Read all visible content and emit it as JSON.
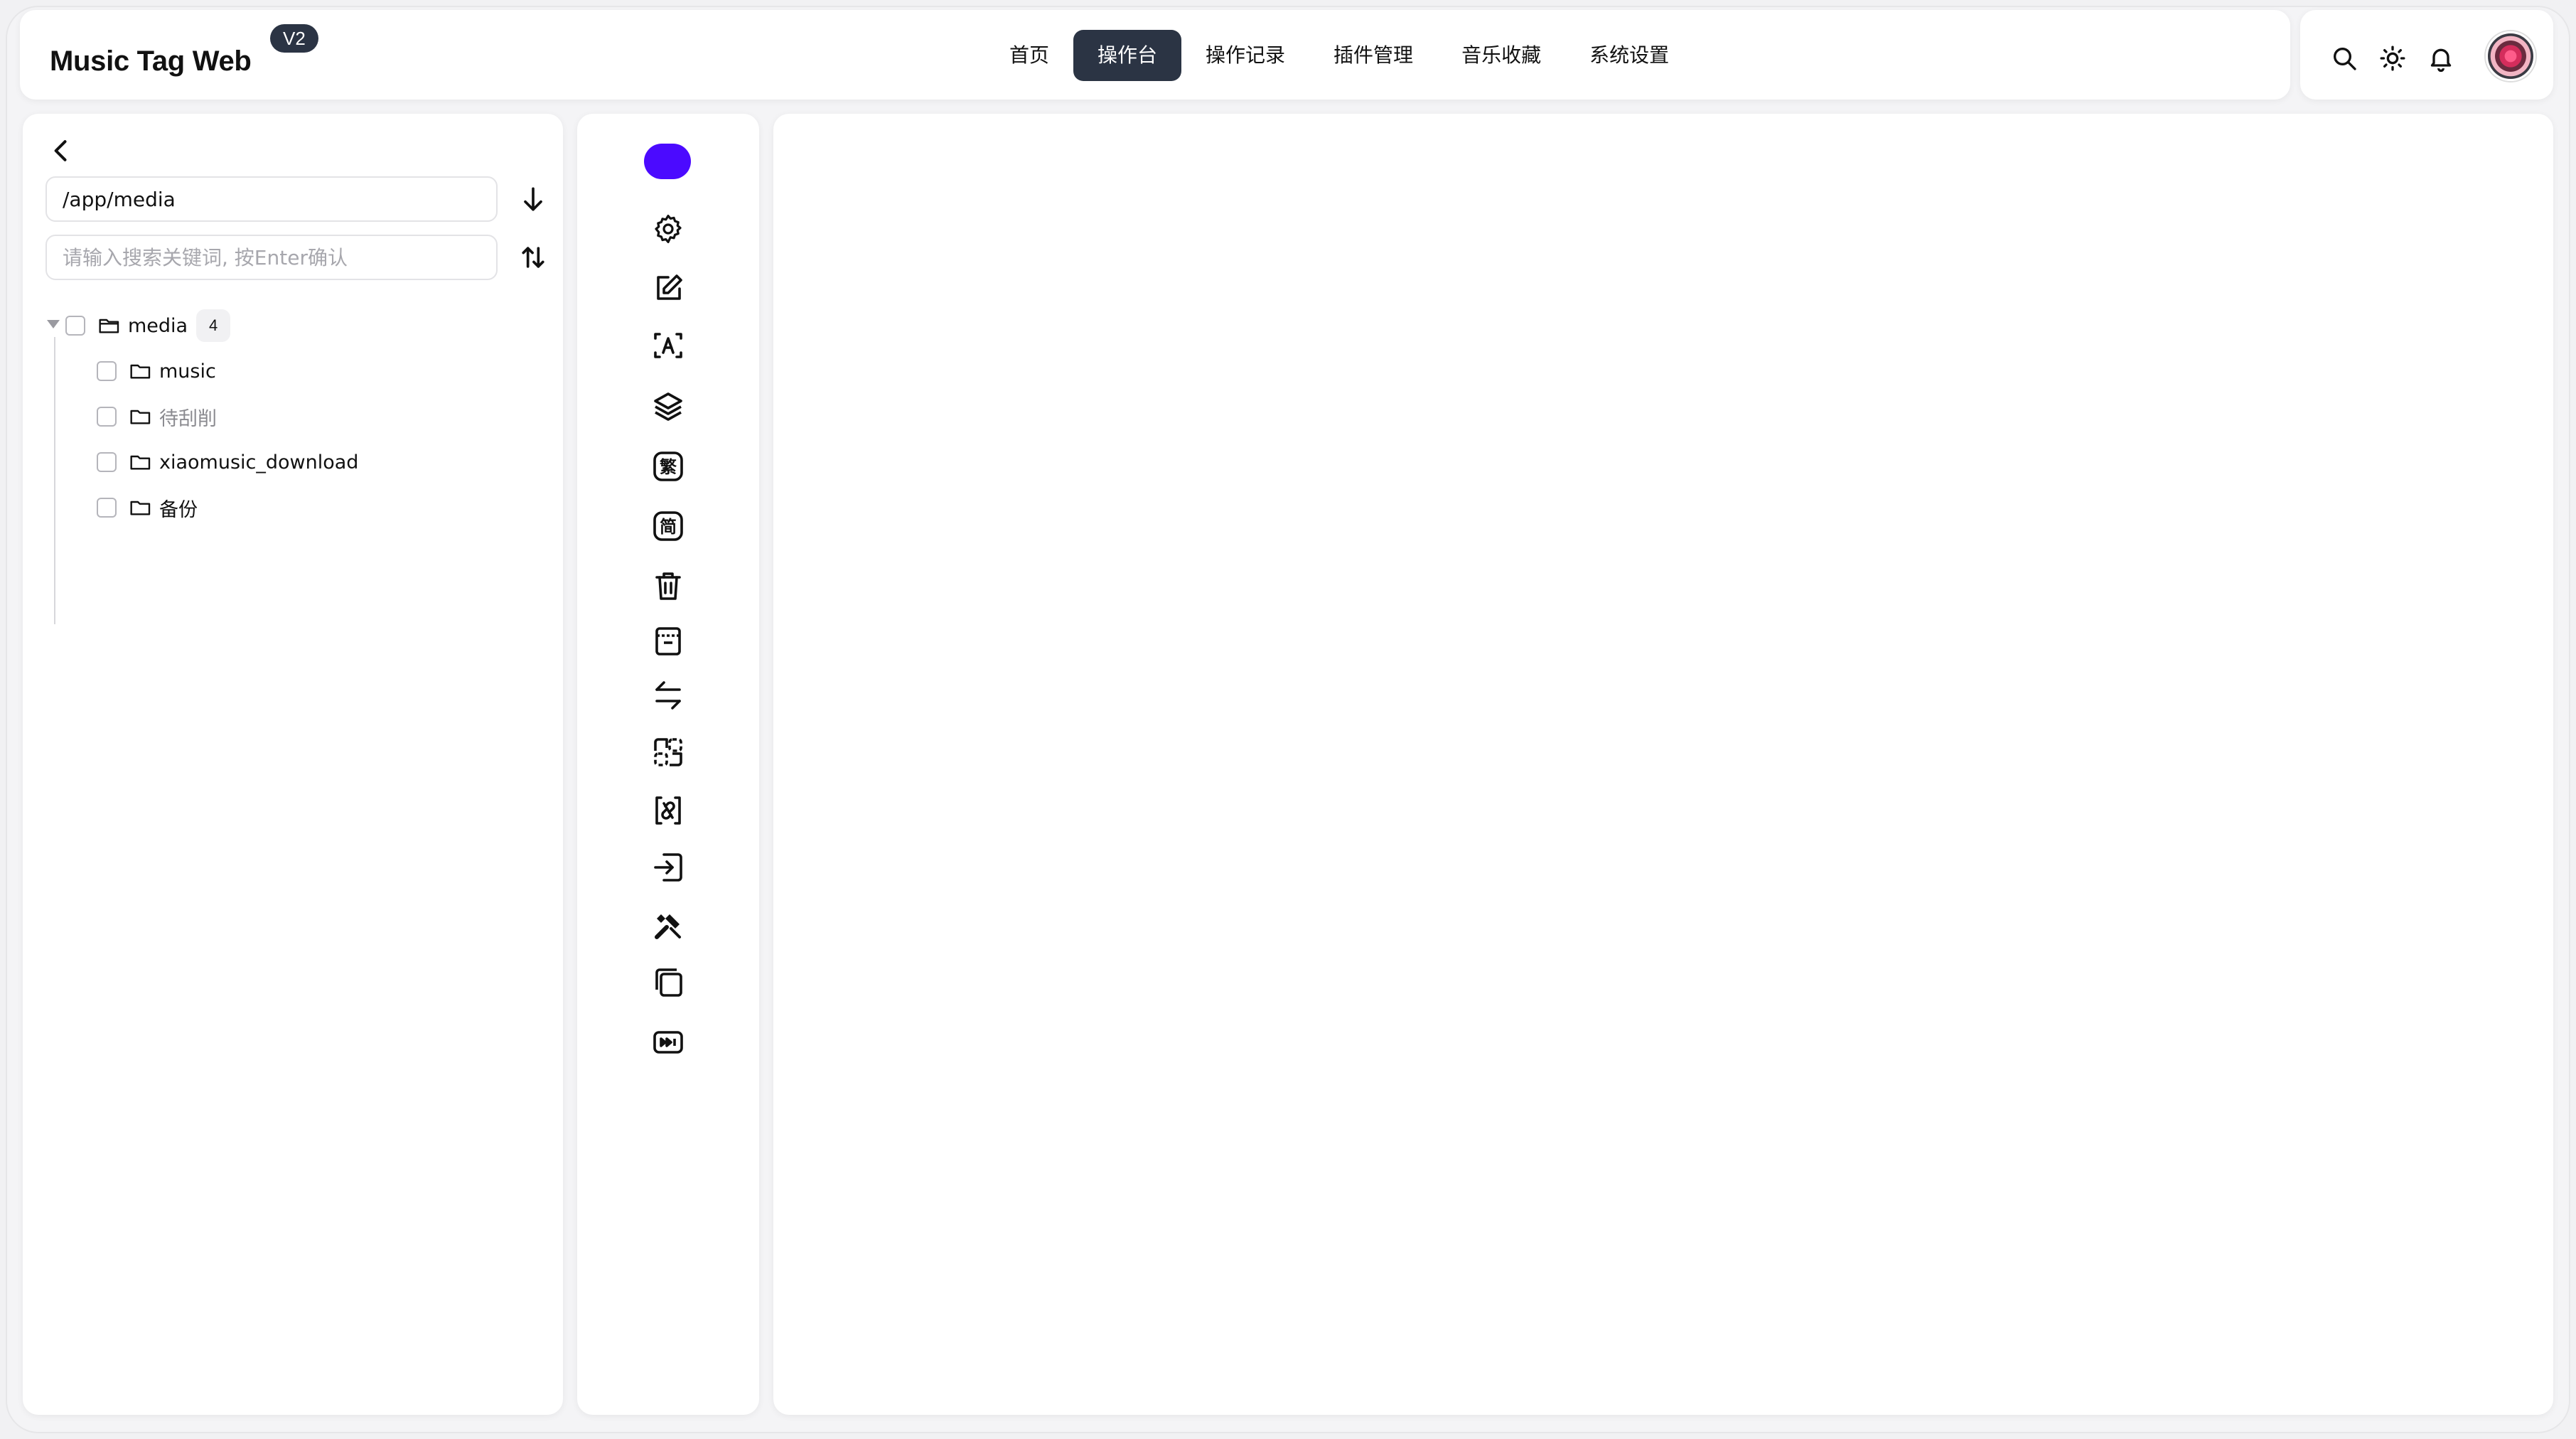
{
  "header": {
    "app_title": "Music Tag Web",
    "version_badge": "V2",
    "nav": [
      {
        "label": "首页",
        "active": false
      },
      {
        "label": "操作台",
        "active": true
      },
      {
        "label": "操作记录",
        "active": false
      },
      {
        "label": "插件管理",
        "active": false
      },
      {
        "label": "音乐收藏",
        "active": false
      },
      {
        "label": "系统设置",
        "active": false
      }
    ],
    "icons": [
      "search-icon",
      "sun-icon",
      "bell-icon",
      "avatar"
    ]
  },
  "sidebar": {
    "path_value": "/app/media",
    "search_placeholder": "请输入搜索关键词, 按Enter确认",
    "tree": {
      "root": {
        "label": "media",
        "count": "4"
      },
      "children": [
        {
          "label": "music"
        },
        {
          "label": "待刮削"
        },
        {
          "label": "xiaomusic_download"
        },
        {
          "label": "备份"
        }
      ]
    }
  },
  "tools": {
    "accent_color": "#4b0aff",
    "icons": [
      "settings-icon",
      "edit-icon",
      "text-recognize-icon",
      "layers-icon",
      "traditional-chinese-icon",
      "simplified-chinese-icon",
      "trash-icon",
      "archive-icon",
      "swap-icon",
      "group-icon",
      "unlink-icon",
      "import-icon",
      "wrench-icon",
      "copy-icon",
      "media-skip-icon"
    ]
  },
  "colors": {
    "nav_active_bg": "#2b3444",
    "accent": "#4b0aff"
  }
}
